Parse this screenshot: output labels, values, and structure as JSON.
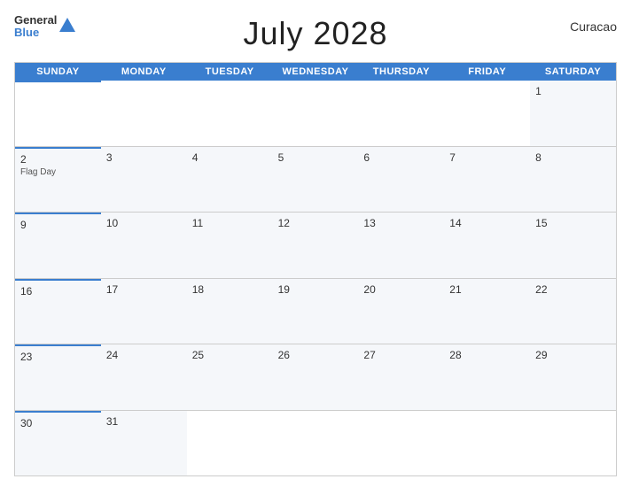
{
  "header": {
    "title": "July 2028",
    "country": "Curacao",
    "logo_general": "General",
    "logo_blue": "Blue"
  },
  "calendar": {
    "days_of_week": [
      "Sunday",
      "Monday",
      "Tuesday",
      "Wednesday",
      "Thursday",
      "Friday",
      "Saturday"
    ],
    "weeks": [
      [
        {
          "date": "",
          "event": ""
        },
        {
          "date": "",
          "event": ""
        },
        {
          "date": "",
          "event": ""
        },
        {
          "date": "",
          "event": ""
        },
        {
          "date": "",
          "event": ""
        },
        {
          "date": "",
          "event": ""
        },
        {
          "date": "1",
          "event": ""
        }
      ],
      [
        {
          "date": "2",
          "event": "Flag Day"
        },
        {
          "date": "3",
          "event": ""
        },
        {
          "date": "4",
          "event": ""
        },
        {
          "date": "5",
          "event": ""
        },
        {
          "date": "6",
          "event": ""
        },
        {
          "date": "7",
          "event": ""
        },
        {
          "date": "8",
          "event": ""
        }
      ],
      [
        {
          "date": "9",
          "event": ""
        },
        {
          "date": "10",
          "event": ""
        },
        {
          "date": "11",
          "event": ""
        },
        {
          "date": "12",
          "event": ""
        },
        {
          "date": "13",
          "event": ""
        },
        {
          "date": "14",
          "event": ""
        },
        {
          "date": "15",
          "event": ""
        }
      ],
      [
        {
          "date": "16",
          "event": ""
        },
        {
          "date": "17",
          "event": ""
        },
        {
          "date": "18",
          "event": ""
        },
        {
          "date": "19",
          "event": ""
        },
        {
          "date": "20",
          "event": ""
        },
        {
          "date": "21",
          "event": ""
        },
        {
          "date": "22",
          "event": ""
        }
      ],
      [
        {
          "date": "23",
          "event": ""
        },
        {
          "date": "24",
          "event": ""
        },
        {
          "date": "25",
          "event": ""
        },
        {
          "date": "26",
          "event": ""
        },
        {
          "date": "27",
          "event": ""
        },
        {
          "date": "28",
          "event": ""
        },
        {
          "date": "29",
          "event": ""
        }
      ],
      [
        {
          "date": "30",
          "event": ""
        },
        {
          "date": "31",
          "event": ""
        },
        {
          "date": "",
          "event": ""
        },
        {
          "date": "",
          "event": ""
        },
        {
          "date": "",
          "event": ""
        },
        {
          "date": "",
          "event": ""
        },
        {
          "date": "",
          "event": ""
        }
      ]
    ]
  }
}
